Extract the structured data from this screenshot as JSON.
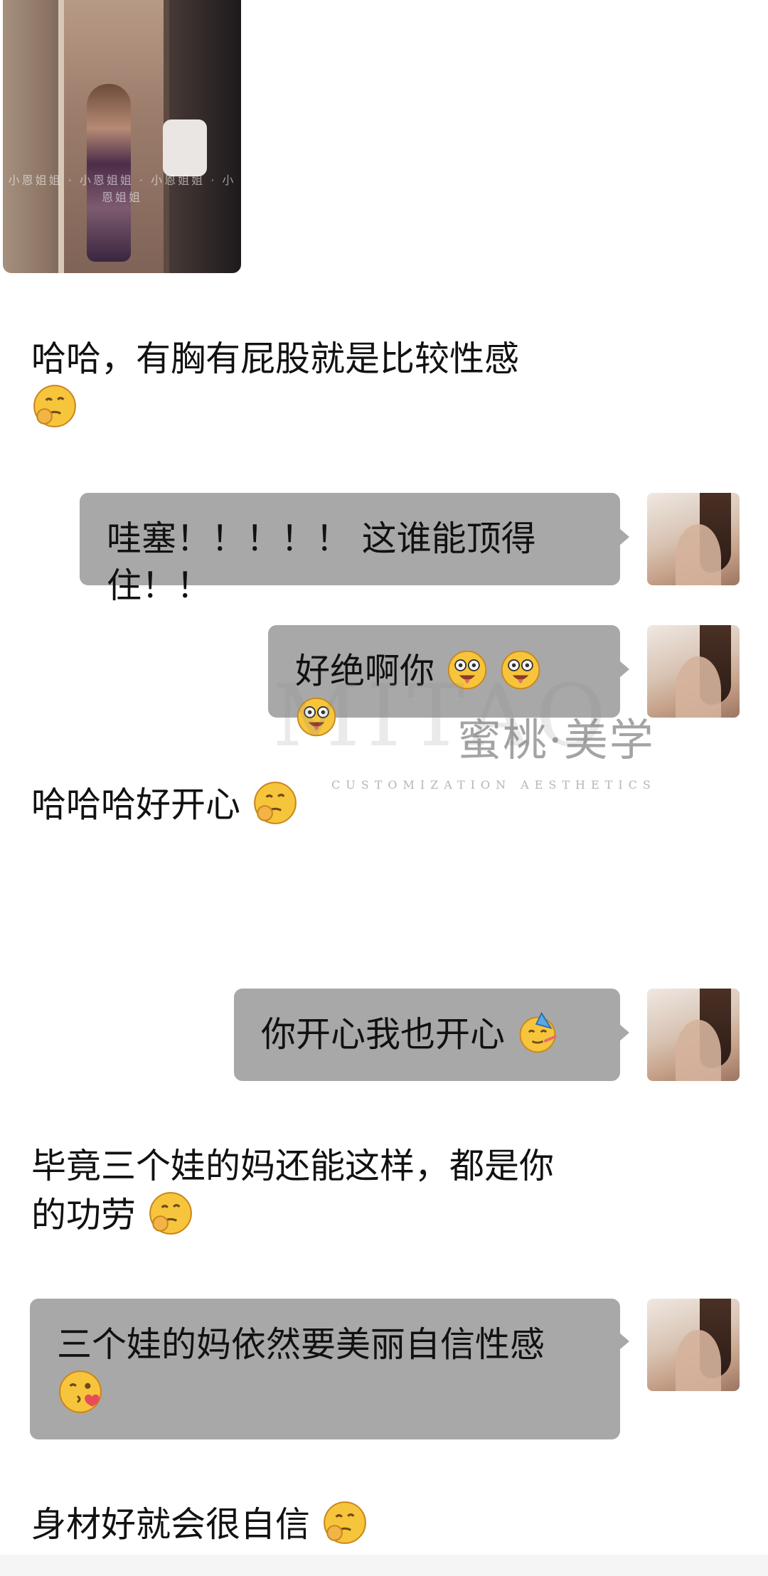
{
  "photo": {
    "watermark": "小恩姐姐 · 小恩姐姐 · 小恩姐姐 · 小恩姐姐"
  },
  "messages": {
    "m1_line1": "哈哈，有胸有屁股就是比较性感",
    "m2": "哇塞！！！！！ 这谁能顶得住！！",
    "m3": "好绝啊你",
    "m4": "哈哈哈好开心",
    "m5": "你开心我也开心",
    "m6_line1": "毕竟三个娃的妈还能这样，都是你",
    "m6_line2": "的功劳",
    "m7_line1": "三个娃的妈依然要美丽自信性感",
    "m8": "身材好就会很自信"
  },
  "watermark": {
    "big": "MITAO",
    "brand": "蜜桃·美学",
    "sub": "CUSTOMIZATION AESTHETICS"
  },
  "icons": {
    "thinking": "thinking-face-icon",
    "crazy": "zany-face-icon",
    "party": "partying-face-icon",
    "kiss": "face-blowing-kiss-icon"
  }
}
